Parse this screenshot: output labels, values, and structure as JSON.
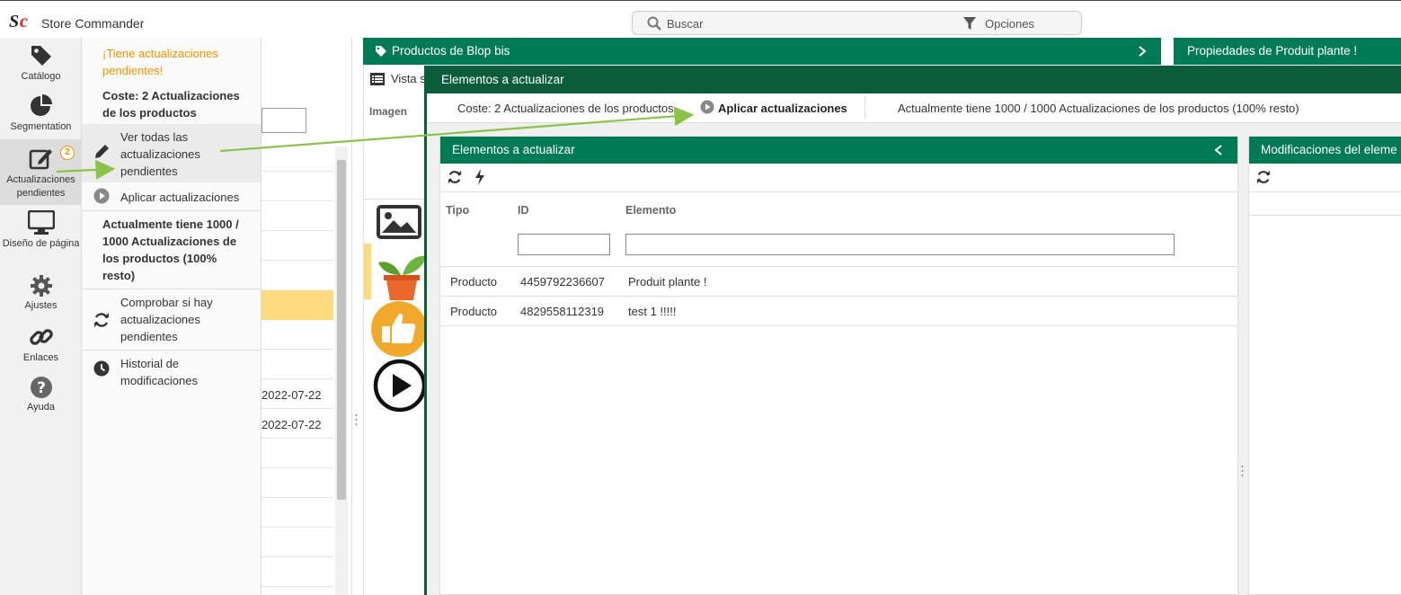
{
  "app": {
    "title": "Store Commander",
    "logo_text": "Sc"
  },
  "search": {
    "placeholder": "Buscar",
    "options_label": "Opciones"
  },
  "sidebar": {
    "items": [
      {
        "label": "Catálogo",
        "icon": "tag-icon"
      },
      {
        "label": "Segmentation",
        "icon": "pie-chart-icon"
      },
      {
        "label": "Actualizaciones pendientes",
        "icon": "edit-icon",
        "badge": "2"
      },
      {
        "label": "Diseño de página",
        "icon": "monitor-icon"
      },
      {
        "label": "Ajustes",
        "icon": "gear-icon"
      },
      {
        "label": "Enlaces",
        "icon": "link-icon"
      },
      {
        "label": "Ayuda",
        "icon": "help-icon"
      }
    ]
  },
  "menu": {
    "alert": "¡Tiene actualizaciones pendientes!",
    "cost": "Coste: 2 Actualizaciones de los productos",
    "view_all": "Ver todas las actualizaciones pendientes",
    "apply": "Aplicar actualizaciones",
    "status": "Actualmente tiene 1000 / 1000 Actualizaciones de los productos (100% resto)",
    "check": "Comprobar si hay actualizaciones pendientes",
    "history": "Historial de modificaciones"
  },
  "background": {
    "dates": [
      "2022-07-22",
      "2022-07-22"
    ],
    "products_panel_title": "Productos de Blop bis",
    "properties_panel_title": "Propiedades de Produit plante !",
    "view_label": "Vista s",
    "image_col": "Imagen"
  },
  "overlay": {
    "title": "Elementos a actualizar",
    "toolbar": {
      "cost": "Coste: 2 Actualizaciones de los productos",
      "apply": "Aplicar actualizaciones",
      "status": "Actualmente tiene 1000 / 1000 Actualizaciones de los productos (100% resto)"
    },
    "elements_panel": {
      "title": "Elementos a actualizar",
      "columns": [
        "Tipo",
        "ID",
        "Elemento"
      ],
      "rows": [
        {
          "type": "Producto",
          "id": "4459792236607",
          "element": "Produit plante !"
        },
        {
          "type": "Producto",
          "id": "4829558112319",
          "element": "test 1 !!!!!"
        }
      ]
    },
    "modifications_panel": {
      "title": "Modificaciones del eleme"
    }
  },
  "colors": {
    "primary_green": "#007a55",
    "dark_green": "#0a5c3b",
    "orange": "#f39200",
    "arrow": "#8bc34a"
  }
}
